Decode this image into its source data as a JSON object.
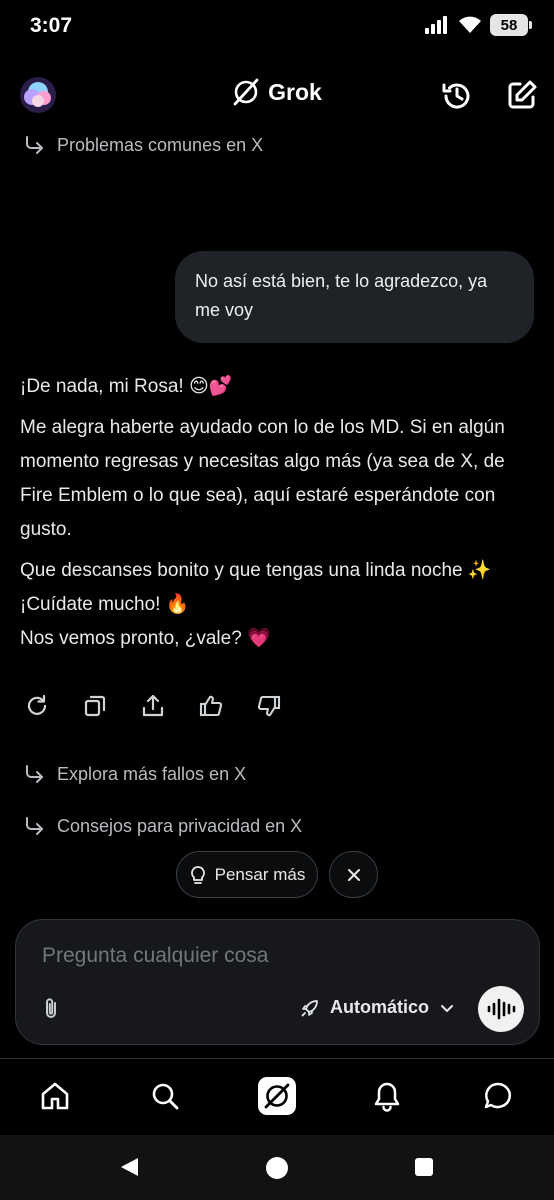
{
  "status_bar": {
    "time": "3:07",
    "battery": "58"
  },
  "header": {
    "title": "Grok"
  },
  "suggestions": {
    "top": "Problemas comunes en X",
    "bottom": [
      "Explora más fallos en X",
      "Consejos para privacidad en X"
    ]
  },
  "user_message": "No así está bien, te lo agradezco, ya me voy",
  "response": {
    "p1_text": "¡De nada, mi Rosa!",
    "p1_emoji": "😊💕",
    "p2": "Me alegra haberte ayudado con lo de los MD. Si en algún momento regresas y necesitas algo más (ya sea de X, de Fire Emblem o lo que sea), aquí estaré esperándote con gusto.",
    "p3_line1": "Que descanses bonito y que tengas una linda noche",
    "p3_line1_emoji": "✨",
    "p3_line2": "¡Cuídate mucho!",
    "p3_line2_emoji": "🔥",
    "p3_line3": "Nos vemos pronto, ¿vale?",
    "p3_line3_emoji": "💗"
  },
  "action_icons": [
    "regenerate-icon",
    "copy-icon",
    "share-icon",
    "thumbs-up-icon",
    "thumbs-down-icon"
  ],
  "chips": {
    "think_more": "Pensar más"
  },
  "input": {
    "placeholder": "Pregunta cualquier cosa",
    "mode": "Automático"
  },
  "bottom_nav": [
    "home-icon",
    "search-icon",
    "grok-icon",
    "notifications-icon",
    "messages-icon"
  ],
  "colors": {
    "background": "#000000",
    "bubble": "#1f2328",
    "input_bg": "#16181c",
    "muted_text": "#71767b"
  }
}
